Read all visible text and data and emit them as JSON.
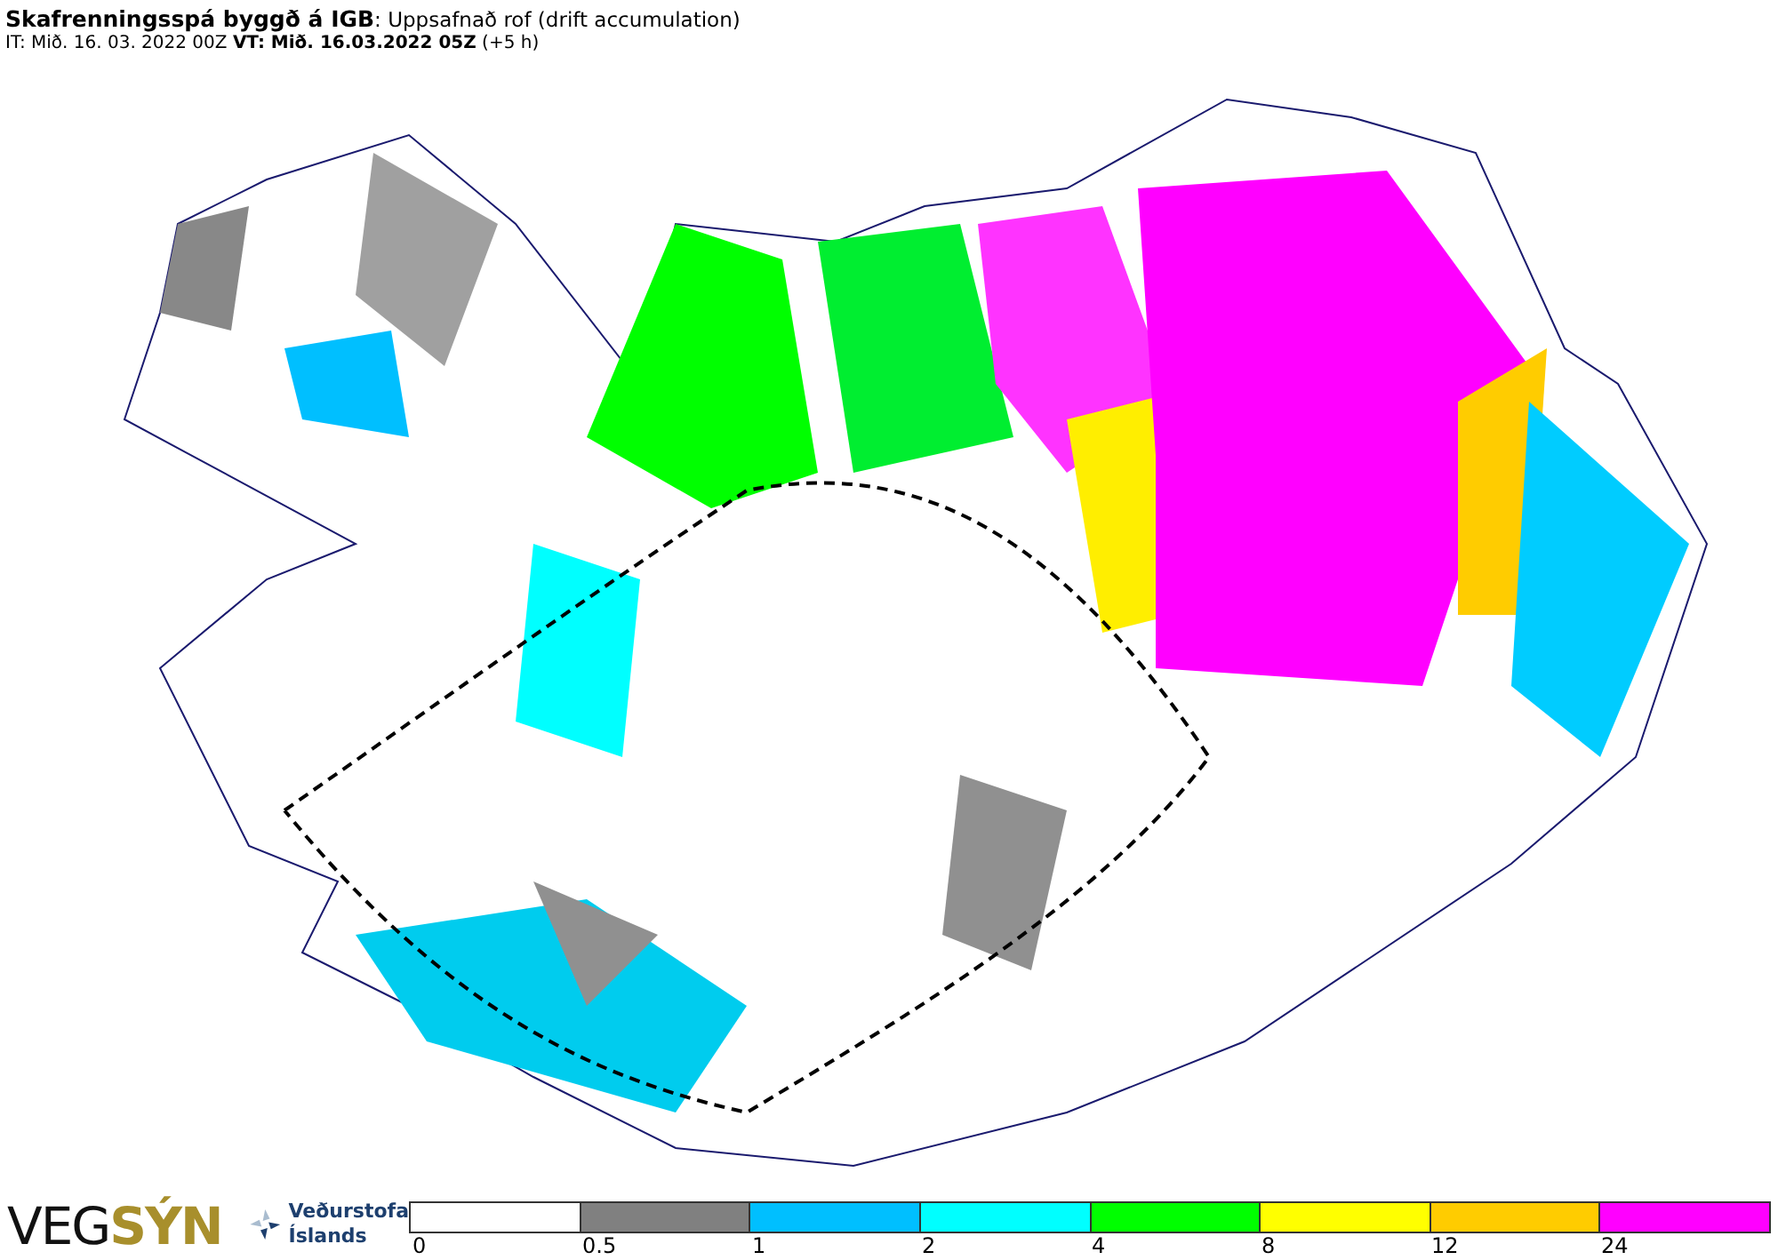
{
  "header": {
    "title": "**Skafrenningsspá byggð á IGB**: Uppsafnað rof (drift accumulation)",
    "subtitle": "IT: Mið. 16. 03. 2022 00Z **VT: Mið. 16.03.2022 05Z** (+5 h)"
  },
  "logos": {
    "vegsyn": "VEG**SÝN**",
    "agency_line_1": "Veðurstofa",
    "agency_line_2": "Íslands"
  },
  "legend": [
    {
      "label": "0",
      "color": "#ffffff"
    },
    {
      "label": "0.5",
      "color": "#808080"
    },
    {
      "label": "1",
      "color": "#00bfff"
    },
    {
      "label": "2",
      "color": "#00ffff"
    },
    {
      "label": "4",
      "color": "#00ff00"
    },
    {
      "label": "8",
      "color": "#ffff00"
    },
    {
      "label": "12",
      "color": "#ffcc00"
    },
    {
      "label": "24",
      "color": "#ff00ff"
    }
  ]
}
